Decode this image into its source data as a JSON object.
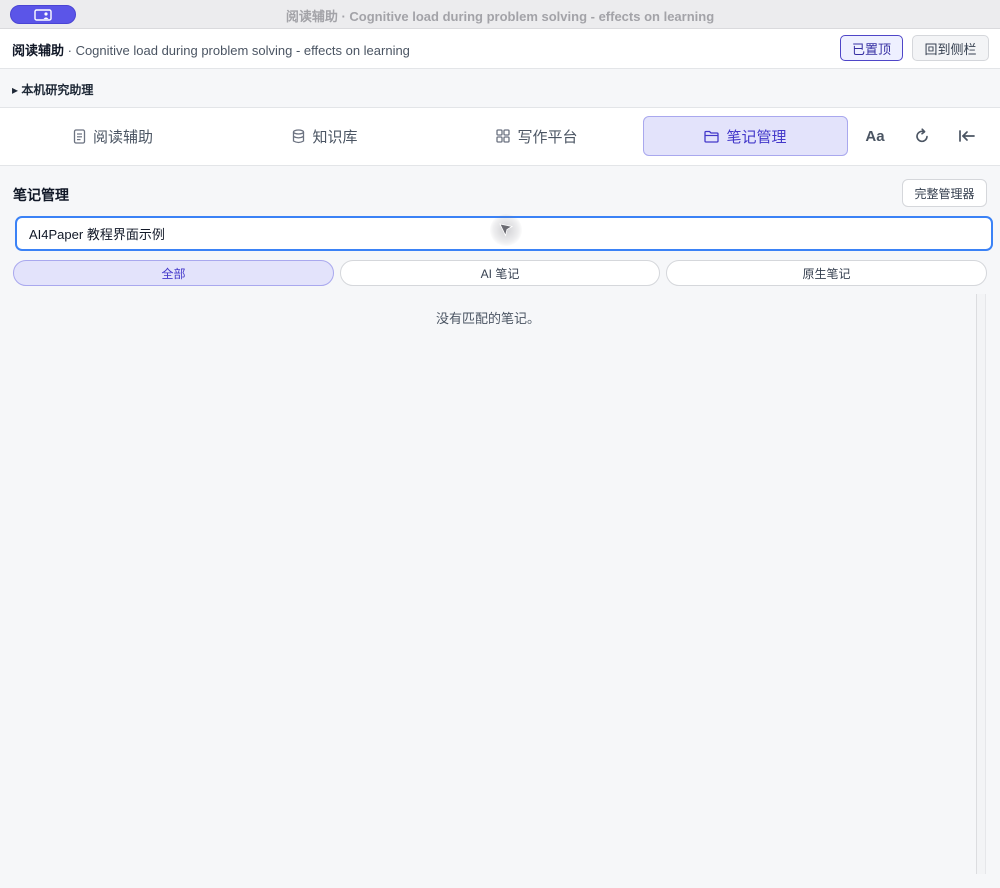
{
  "window": {
    "title": "阅读辅助 · Cognitive load during problem solving - effects on learning",
    "pill_icon": "sidebar-user-icon"
  },
  "header": {
    "title_strong": "阅读辅助",
    "title_rest": " · Cognitive load during problem solving - effects on learning",
    "pinned_label": "已置顶",
    "back_label": "回到侧栏"
  },
  "assistant": {
    "label": "▸ 本机研究助理"
  },
  "tabs": [
    {
      "label": "阅读辅助",
      "icon": "document-icon",
      "active": false
    },
    {
      "label": "知识库",
      "icon": "database-icon",
      "active": false
    },
    {
      "label": "写作平台",
      "icon": "grid-icon",
      "active": false
    },
    {
      "label": "笔记管理",
      "icon": "folder-icon",
      "active": true
    }
  ],
  "tools": {
    "font_label": "Aa",
    "refresh_icon": "refresh-icon",
    "collapse_icon": "collapse-left-icon"
  },
  "notes": {
    "section_title": "笔记管理",
    "full_manager_label": "完整管理器",
    "search_value": "AI4Paper 教程界面示例",
    "filters": [
      {
        "label": "全部",
        "active": true
      },
      {
        "label": "AI 笔记",
        "active": false
      },
      {
        "label": "原生笔记",
        "active": false
      }
    ],
    "empty_message": "没有匹配的笔记。"
  },
  "colors": {
    "accent": "#4338ca",
    "accent_bg": "#e3e3fb",
    "focus": "#3b82f6",
    "pill": "#5b55e8"
  }
}
